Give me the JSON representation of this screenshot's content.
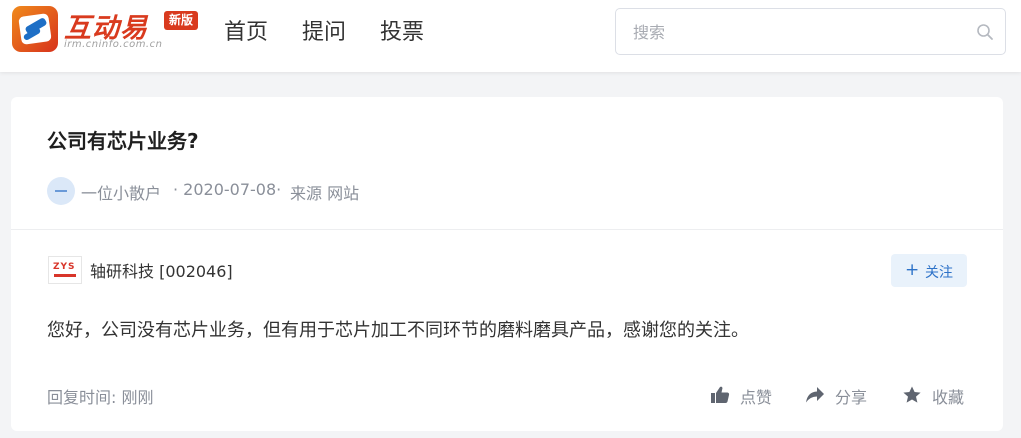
{
  "header": {
    "logo": {
      "name": "互动易",
      "url_text": "irm.cninfo.com.cn",
      "badge": "新版"
    },
    "nav": [
      "首页",
      "提问",
      "投票"
    ],
    "search": {
      "placeholder": "搜索",
      "value": ""
    }
  },
  "question": {
    "title": "公司有芯片业务?",
    "asker": "一位小散户",
    "date": "· 2020-07-08·",
    "source": "来源 网站"
  },
  "answer": {
    "company": "轴研科技 [002046]",
    "company_logo_text": "ZYS",
    "follow_label": "关注",
    "text": "您好，公司没有芯片业务，但有用于芯片加工不同环节的磨料磨具产品，感谢您的关注。",
    "reply_time": "回复时间:  刚刚"
  },
  "actions": {
    "like": "点赞",
    "share": "分享",
    "favorite": "收藏"
  },
  "colors": {
    "brand_red": "#d93a1e",
    "accent_blue": "#2d72c8",
    "muted_text": "#8a8f99",
    "background": "#f3f4f6"
  },
  "icons": [
    "search-icon",
    "thumbs-up-icon",
    "share-arrow-icon",
    "star-icon",
    "plus-icon"
  ]
}
